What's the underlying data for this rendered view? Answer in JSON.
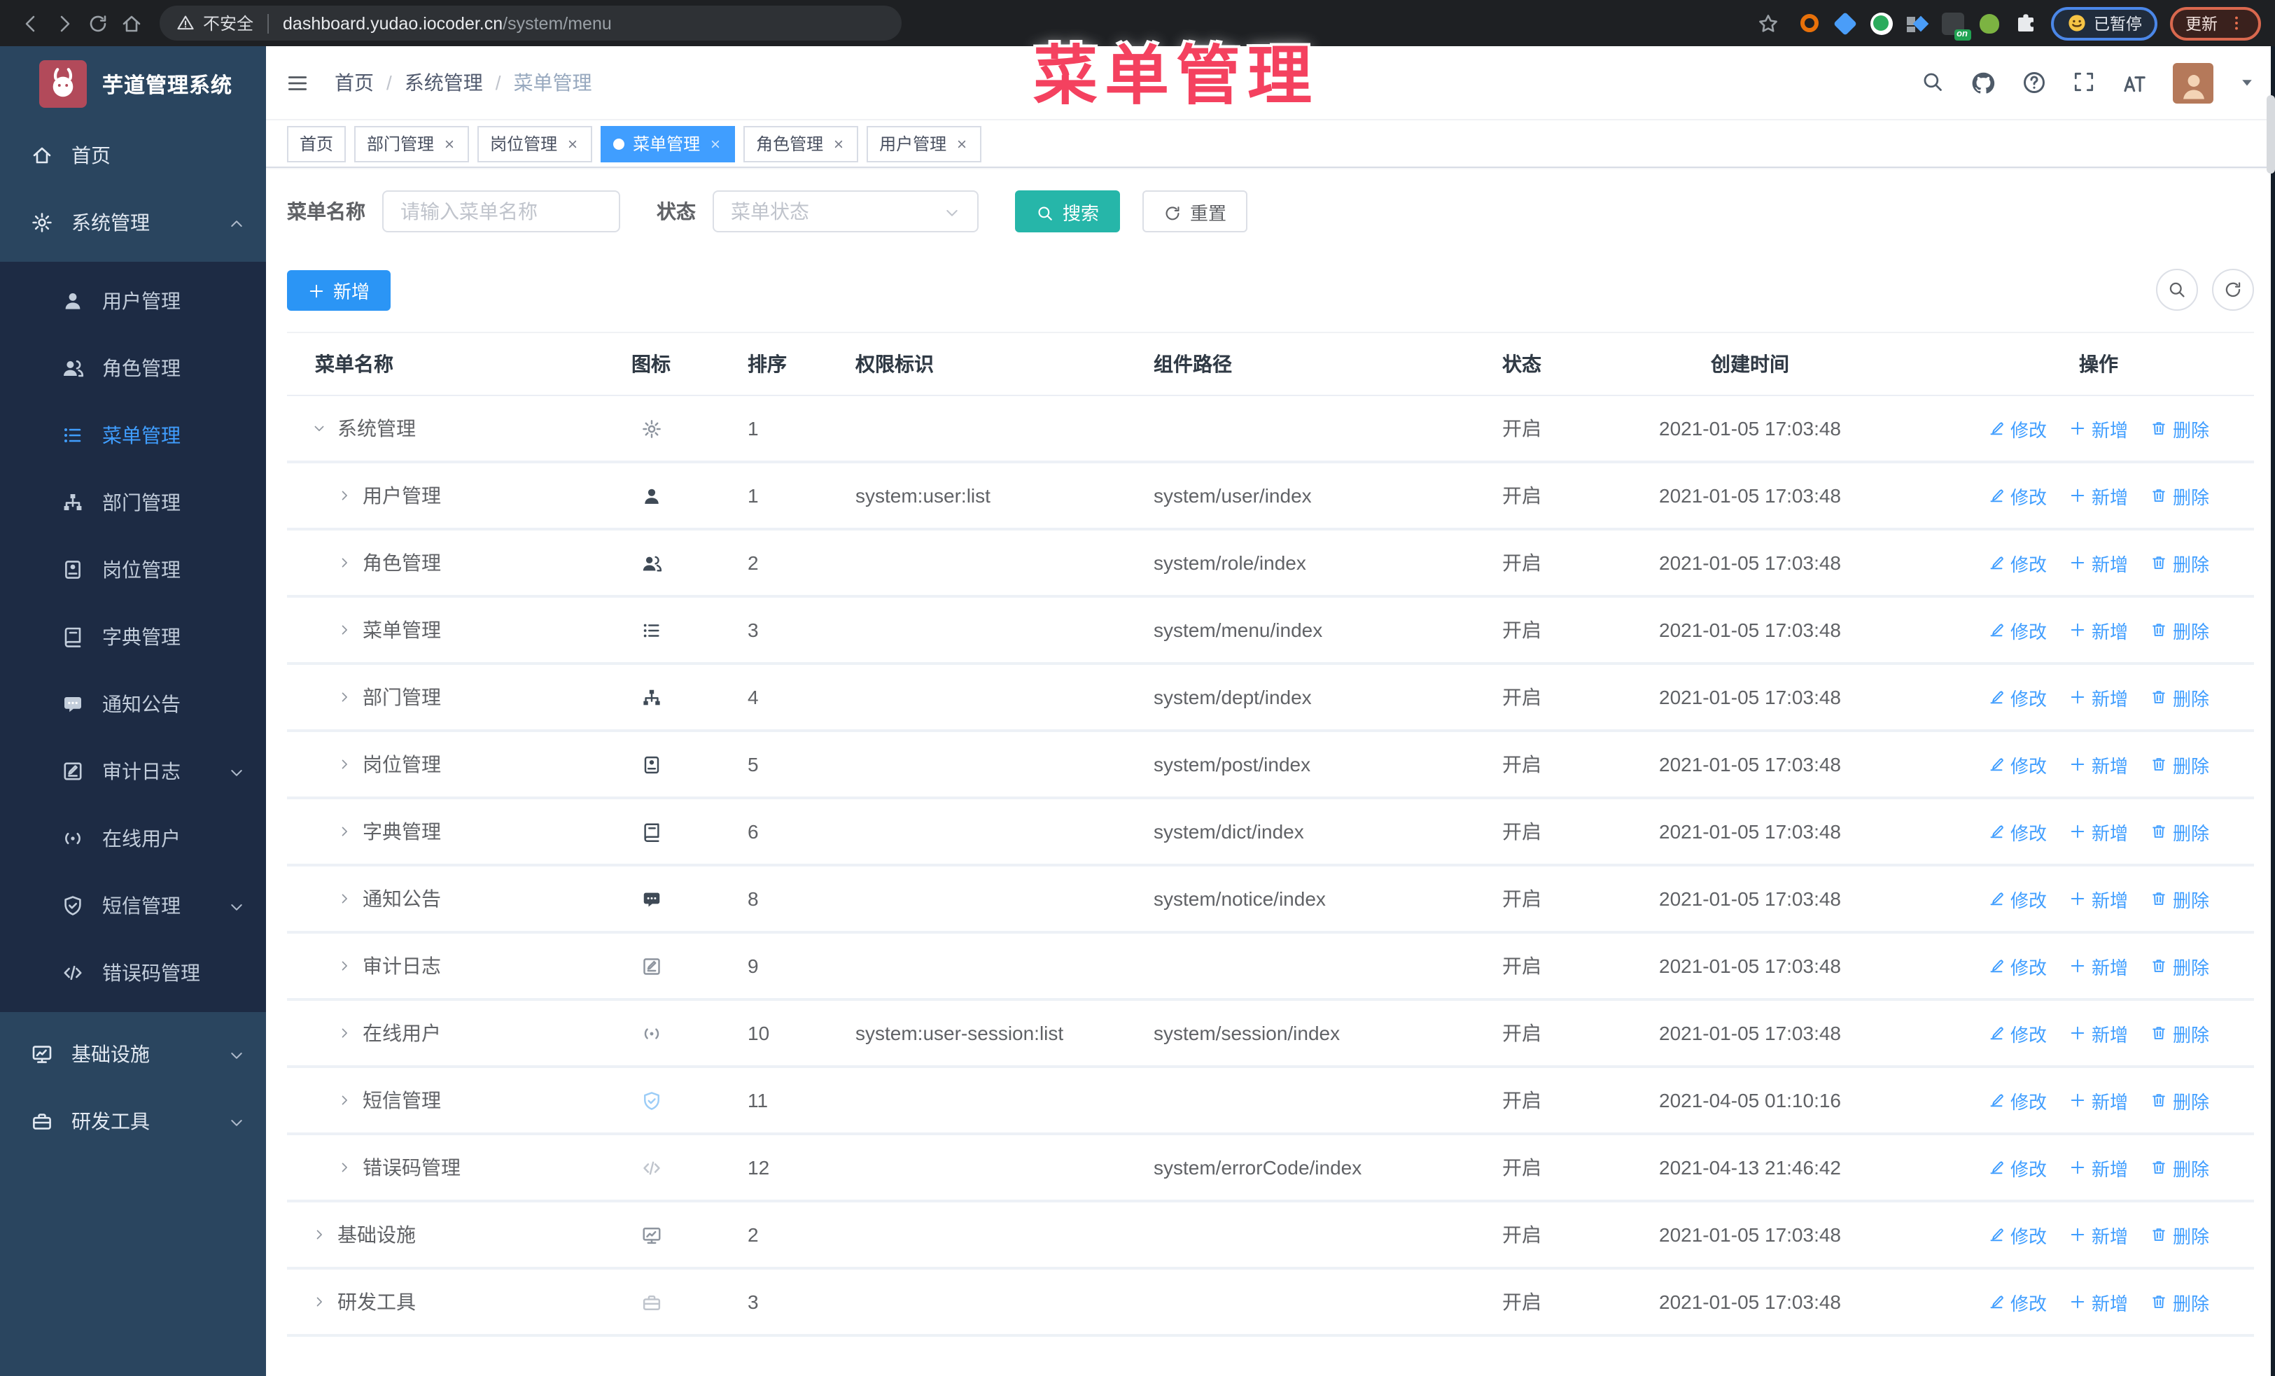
{
  "browser": {
    "security_label": "不安全",
    "url_host": "dashboard.yudao.iocoder.cn",
    "url_path": "/system/menu",
    "paused_badge": "已暂停",
    "update_label": "更新",
    "extension_on_badge": "on"
  },
  "overlay_title": "菜单管理",
  "colors": {
    "accent_blue": "#409eff",
    "add_button_blue": "#2b95f5",
    "search_teal": "#26b6a9",
    "overlay_pink": "#f4415f",
    "sidebar_bg": "#2a455f",
    "submenu_bg": "#1d2b44",
    "browser_bg": "#1e2023"
  },
  "sidebar": {
    "app_title": "芋道管理系统",
    "items": [
      {
        "label": "首页",
        "icon": "home-icon",
        "level": 1
      },
      {
        "label": "系统管理",
        "icon": "gear-icon",
        "level": 1,
        "chevron": "up"
      },
      {
        "label": "用户管理",
        "icon": "user-icon",
        "level": 2
      },
      {
        "label": "角色管理",
        "icon": "users-icon",
        "level": 2
      },
      {
        "label": "菜单管理",
        "icon": "menu-icon",
        "level": 2,
        "active": true
      },
      {
        "label": "部门管理",
        "icon": "org-tree-icon",
        "level": 2
      },
      {
        "label": "岗位管理",
        "icon": "badge-icon",
        "level": 2
      },
      {
        "label": "字典管理",
        "icon": "book-icon",
        "level": 2
      },
      {
        "label": "通知公告",
        "icon": "megaphone-icon",
        "level": 2
      },
      {
        "label": "审计日志",
        "icon": "log-icon",
        "level": 2,
        "chevron": "down"
      },
      {
        "label": "在线用户",
        "icon": "online-icon",
        "level": 2
      },
      {
        "label": "短信管理",
        "icon": "shield-icon",
        "level": 2,
        "chevron": "down"
      },
      {
        "label": "错误码管理",
        "icon": "code-icon",
        "level": 2
      },
      {
        "label": "基础设施",
        "icon": "monitor-icon",
        "level": 1,
        "chevron": "down"
      },
      {
        "label": "研发工具",
        "icon": "toolbox-icon",
        "level": 1,
        "chevron": "down"
      }
    ]
  },
  "header": {
    "breadcrumb": [
      "首页",
      "系统管理",
      "菜单管理"
    ]
  },
  "tabs": [
    {
      "label": "首页",
      "closable": false,
      "active": false
    },
    {
      "label": "部门管理",
      "closable": true,
      "active": false
    },
    {
      "label": "岗位管理",
      "closable": true,
      "active": false
    },
    {
      "label": "菜单管理",
      "closable": true,
      "active": true
    },
    {
      "label": "角色管理",
      "closable": true,
      "active": false
    },
    {
      "label": "用户管理",
      "closable": true,
      "active": false
    }
  ],
  "filters": {
    "name_label": "菜单名称",
    "name_placeholder": "请输入菜单名称",
    "status_label": "状态",
    "status_placeholder": "菜单状态",
    "search_label": "搜索",
    "reset_label": "重置"
  },
  "toolbar": {
    "add_label": "新增"
  },
  "table": {
    "columns": [
      "菜单名称",
      "图标",
      "排序",
      "权限标识",
      "组件路径",
      "状态",
      "创建时间",
      "操作"
    ],
    "actions": [
      {
        "label": "修改",
        "icon": "edit-icon"
      },
      {
        "label": "新增",
        "icon": "plus-icon"
      },
      {
        "label": "删除",
        "icon": "trash-icon"
      }
    ],
    "rows": [
      {
        "name": "系统管理",
        "level": 1,
        "expanded": true,
        "icon": "gear-icon",
        "tone": "muted",
        "order": "1",
        "perm": "",
        "path": "",
        "status": "开启",
        "created": "2021-01-05 17:03:48"
      },
      {
        "name": "用户管理",
        "level": 2,
        "expanded": false,
        "icon": "user-icon",
        "tone": "dark",
        "order": "1",
        "perm": "system:user:list",
        "path": "system/user/index",
        "status": "开启",
        "created": "2021-01-05 17:03:48"
      },
      {
        "name": "角色管理",
        "level": 2,
        "expanded": false,
        "icon": "users-icon",
        "tone": "dark",
        "order": "2",
        "perm": "",
        "path": "system/role/index",
        "status": "开启",
        "created": "2021-01-05 17:03:48"
      },
      {
        "name": "菜单管理",
        "level": 2,
        "expanded": false,
        "icon": "menu-icon",
        "tone": "dark",
        "order": "3",
        "perm": "",
        "path": "system/menu/index",
        "status": "开启",
        "created": "2021-01-05 17:03:48"
      },
      {
        "name": "部门管理",
        "level": 2,
        "expanded": false,
        "icon": "org-tree-icon",
        "tone": "dark",
        "order": "4",
        "perm": "",
        "path": "system/dept/index",
        "status": "开启",
        "created": "2021-01-05 17:03:48"
      },
      {
        "name": "岗位管理",
        "level": 2,
        "expanded": false,
        "icon": "badge-icon",
        "tone": "dark",
        "order": "5",
        "perm": "",
        "path": "system/post/index",
        "status": "开启",
        "created": "2021-01-05 17:03:48"
      },
      {
        "name": "字典管理",
        "level": 2,
        "expanded": false,
        "icon": "book-icon",
        "tone": "dark",
        "order": "6",
        "perm": "",
        "path": "system/dict/index",
        "status": "开启",
        "created": "2021-01-05 17:03:48"
      },
      {
        "name": "通知公告",
        "level": 2,
        "expanded": false,
        "icon": "megaphone-icon",
        "tone": "dark",
        "order": "8",
        "perm": "",
        "path": "system/notice/index",
        "status": "开启",
        "created": "2021-01-05 17:03:48"
      },
      {
        "name": "审计日志",
        "level": 2,
        "expanded": false,
        "icon": "log-icon",
        "tone": "muted",
        "order": "9",
        "perm": "",
        "path": "",
        "status": "开启",
        "created": "2021-01-05 17:03:48"
      },
      {
        "name": "在线用户",
        "level": 2,
        "expanded": false,
        "icon": "online-icon",
        "tone": "muted",
        "order": "10",
        "perm": "system:user-session:list",
        "path": "system/session/index",
        "status": "开启",
        "created": "2021-01-05 17:03:48"
      },
      {
        "name": "短信管理",
        "level": 2,
        "expanded": false,
        "icon": "shield-icon",
        "tone": "blue",
        "order": "11",
        "perm": "",
        "path": "",
        "status": "开启",
        "created": "2021-04-05 01:10:16"
      },
      {
        "name": "错误码管理",
        "level": 2,
        "expanded": false,
        "icon": "code-icon",
        "tone": "light",
        "order": "12",
        "perm": "",
        "path": "system/errorCode/index",
        "status": "开启",
        "created": "2021-04-13 21:46:42"
      },
      {
        "name": "基础设施",
        "level": 1,
        "expanded": false,
        "icon": "monitor-icon",
        "tone": "muted",
        "order": "2",
        "perm": "",
        "path": "",
        "status": "开启",
        "created": "2021-01-05 17:03:48"
      },
      {
        "name": "研发工具",
        "level": 1,
        "expanded": false,
        "icon": "toolbox-icon",
        "tone": "light",
        "order": "3",
        "perm": "",
        "path": "",
        "status": "开启",
        "created": "2021-01-05 17:03:48"
      }
    ]
  }
}
